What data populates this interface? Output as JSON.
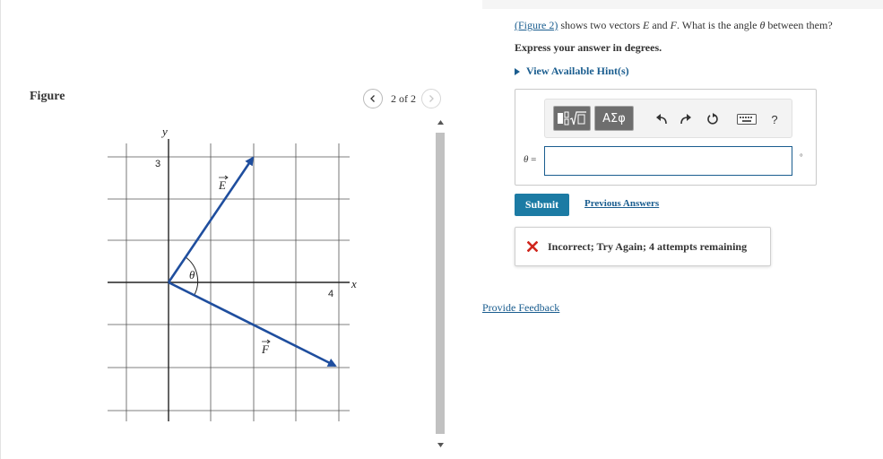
{
  "figure": {
    "title": "Figure",
    "pager_text": "2 of 2",
    "prev_icon": "chevron-left-icon",
    "next_icon": "chevron-right-icon",
    "labels": {
      "y_axis": "y",
      "x_axis": "x",
      "y_tick": "3",
      "x_tick": "4",
      "vector_e": "E",
      "vector_f": "F",
      "angle": "θ"
    },
    "vector_color": "#1f4e9e"
  },
  "question": {
    "figure_link": "(Figure 2)",
    "text_1": " shows two vectors ",
    "vec_e": "E",
    "text_and": " and ",
    "vec_f": "F",
    "text_2": ". What is the angle ",
    "theta": "θ",
    "text_3": " between them?",
    "instruction": "Express your answer in degrees.",
    "hints_label": "View Available Hint(s)"
  },
  "answer": {
    "toolbar": {
      "templates_icon": "templates-icon",
      "symbols_label": "ΑΣφ",
      "undo_icon": "undo-icon",
      "redo_icon": "redo-icon",
      "reset_icon": "reset-icon",
      "keyboard_icon": "keyboard-icon",
      "help_label": "?"
    },
    "variable": "θ",
    "equals": " =",
    "input_value": "",
    "unit": "°"
  },
  "actions": {
    "submit_label": "Submit",
    "previous_answers_label": "Previous Answers"
  },
  "feedback": {
    "icon": "x-icon",
    "text": "Incorrect; Try Again; 4 attempts remaining",
    "icon_color": "#d0261d"
  },
  "footer": {
    "provide_feedback_label": "Provide Feedback"
  },
  "colors": {
    "link": "#1a5d8f",
    "submit": "#1c7ba4"
  }
}
